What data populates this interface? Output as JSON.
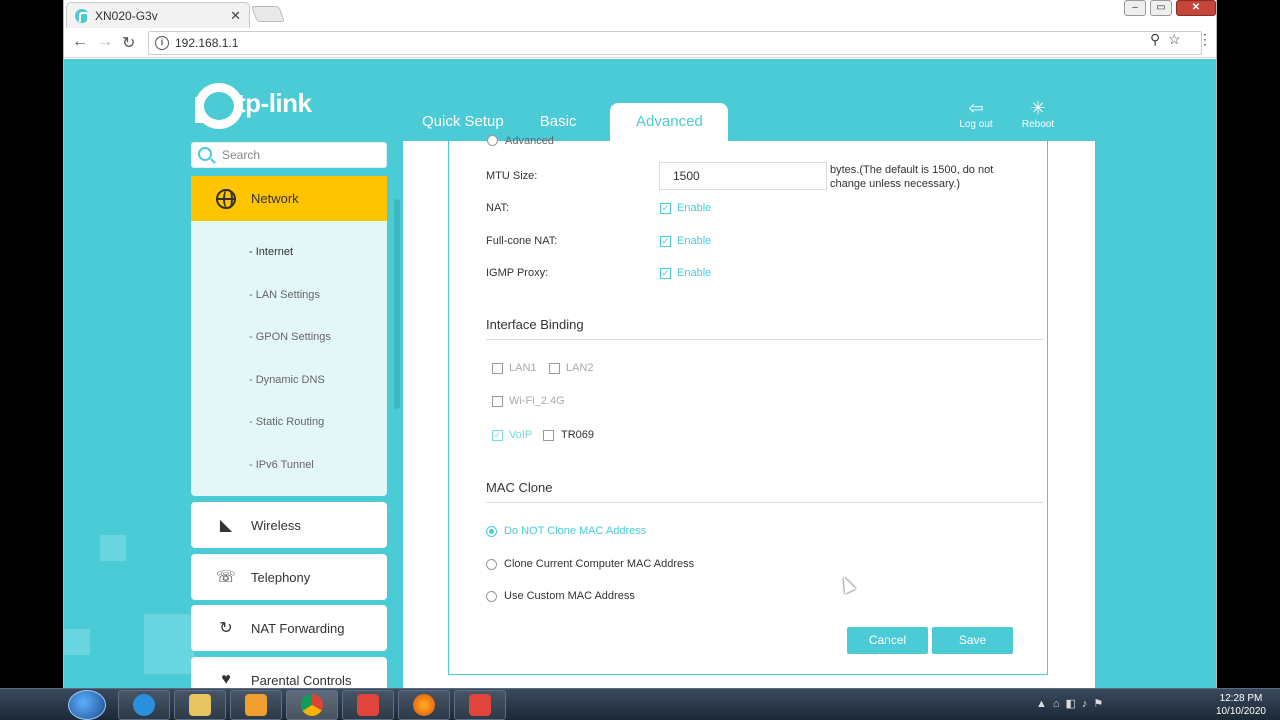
{
  "browser": {
    "tab_title": "XN020-G3v",
    "url": "192.168.1.1",
    "close_glyph": "✕",
    "back_glyph": "←",
    "forward_glyph": "→",
    "reload_glyph": "↻",
    "star_glyph": "☆",
    "menu_glyph": "⋮",
    "key_glyph": "⚲"
  },
  "header": {
    "logo_text": "tp-link",
    "tabs": [
      {
        "label": "Quick Setup"
      },
      {
        "label": "Basic"
      },
      {
        "label": "Advanced"
      }
    ],
    "logout_label": "Log out",
    "reboot_label": "Reboot"
  },
  "sidebar": {
    "search_placeholder": "Search",
    "network": {
      "label": "Network",
      "items": [
        {
          "label": "- Internet"
        },
        {
          "label": "- LAN Settings"
        },
        {
          "label": "- GPON Settings"
        },
        {
          "label": "- Dynamic DNS"
        },
        {
          "label": "- Static Routing"
        },
        {
          "label": "- IPv6 Tunnel"
        }
      ]
    },
    "menus": [
      {
        "label": "Wireless",
        "icon": "wifi-icon"
      },
      {
        "label": "Telephony",
        "icon": "phone-icon"
      },
      {
        "label": "NAT Forwarding",
        "icon": "nat-icon"
      },
      {
        "label": "Parental Controls",
        "icon": "heart-icon"
      }
    ]
  },
  "form": {
    "advanced_label": "Advanced",
    "mtu_label": "MTU Size:",
    "mtu_value": "1500",
    "mtu_hint": "bytes.(The default is 1500, do not change unless necessary.)",
    "nat_label": "NAT:",
    "fullcone_label": "Full-cone NAT:",
    "igmp_label": "IGMP Proxy:",
    "enable_label": "Enable",
    "interface_binding_title": "Interface Binding",
    "bindings": {
      "lan1": "LAN1",
      "lan2": "LAN2",
      "wifi": "Wi-Fi_2.4G",
      "voip": "VoIP",
      "tr069": "TR069"
    },
    "mac_clone_title": "MAC Clone",
    "mac_options": [
      {
        "label": "Do NOT Clone MAC Address",
        "selected": true
      },
      {
        "label": "Clone Current Computer MAC Address",
        "selected": false
      },
      {
        "label": "Use Custom MAC Address",
        "selected": false
      }
    ],
    "cancel_label": "Cancel",
    "save_label": "Save"
  },
  "taskbar": {
    "time": "12:28 PM",
    "date": "10/10/2020"
  },
  "colors": {
    "accent": "#4acbd6",
    "active_menu": "#ffc400"
  }
}
